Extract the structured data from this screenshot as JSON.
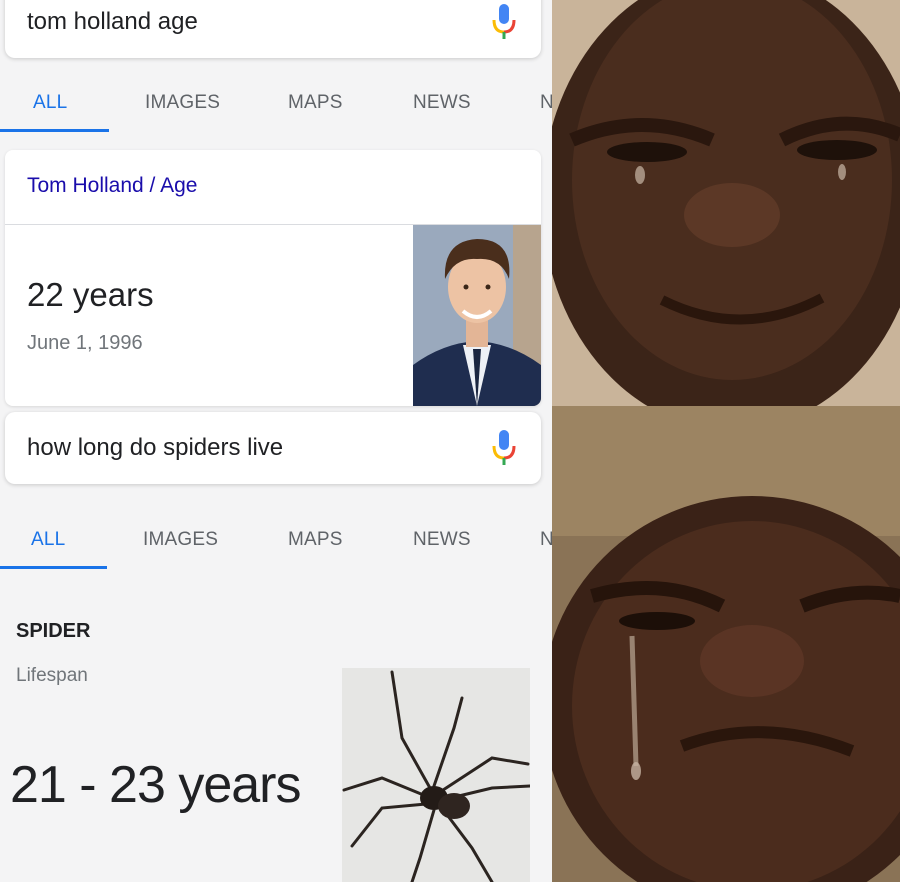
{
  "top_panel": {
    "search": {
      "query": "tom holland age"
    },
    "tabs": [
      {
        "label": "ALL",
        "active": true
      },
      {
        "label": "IMAGES",
        "active": false
      },
      {
        "label": "MAPS",
        "active": false
      },
      {
        "label": "NEWS",
        "active": false
      },
      {
        "label": "N",
        "active": false
      }
    ],
    "result": {
      "breadcrumb": "Tom Holland / Age",
      "age": "22 years",
      "birth_date": "June 1, 1996"
    }
  },
  "bottom_panel": {
    "search": {
      "query": "how long do spiders live"
    },
    "tabs": [
      {
        "label": "ALL",
        "active": true
      },
      {
        "label": "IMAGES",
        "active": false
      },
      {
        "label": "MAPS",
        "active": false
      },
      {
        "label": "NEWS",
        "active": false
      },
      {
        "label": "N",
        "active": false
      }
    ],
    "result": {
      "title": "SPIDER",
      "subtitle": "Lifespan",
      "value": "21 - 23 years"
    }
  },
  "colors": {
    "active_tab": "#1a73e8",
    "link": "#1a0dab",
    "muted": "#70757a",
    "text": "#202124"
  },
  "icons": [
    "microphone-icon"
  ]
}
